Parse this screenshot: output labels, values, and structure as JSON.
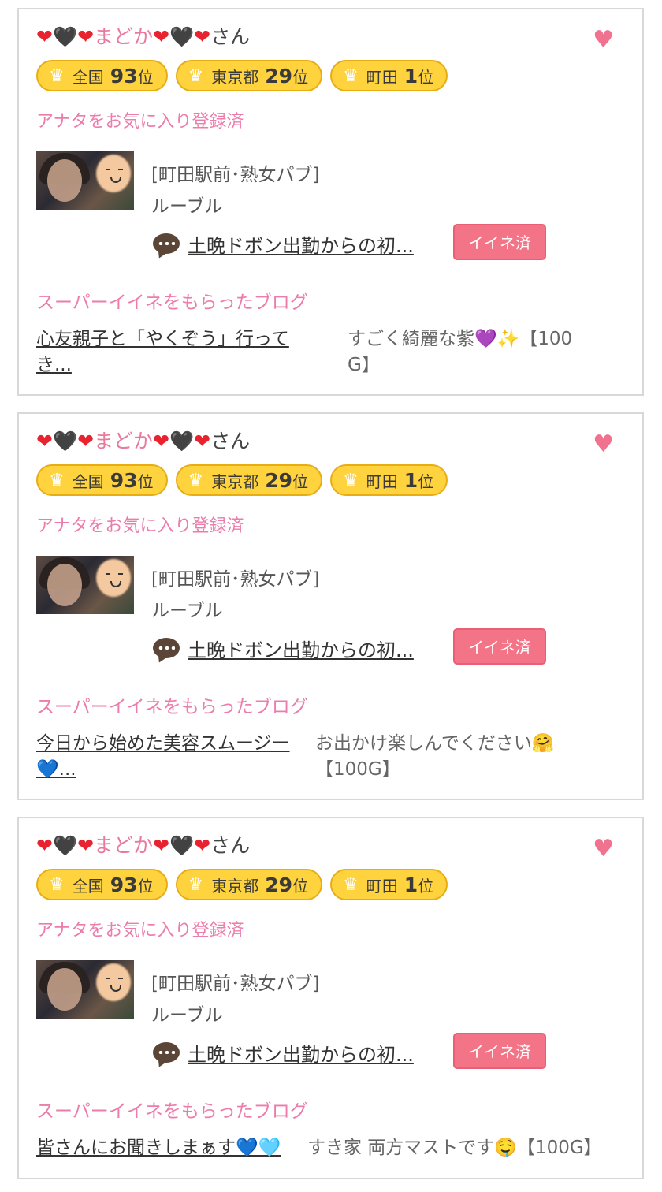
{
  "cards": [
    {
      "name_prefix": "❤🖤❤",
      "name_main": "まどか",
      "name_suffix_hearts": "❤🖤❤",
      "name_suffix": "さん",
      "badges": [
        {
          "area": "全国",
          "rank": "93",
          "unit": "位"
        },
        {
          "area": "東京都",
          "rank": "29",
          "unit": "位"
        },
        {
          "area": "町田",
          "rank": "1",
          "unit": "位"
        }
      ],
      "fav_status": "アナタをお気に入り登録済",
      "shop_line1": "[町田駅前･熟女パブ]",
      "shop_line2": "ルーブル",
      "comment_link": "土晩ドボン出勤からの初...",
      "iine_label": "イイネ済",
      "super_title": "スーパーイイネをもらったブログ",
      "blog_link_line1": "心友親子と「やくぞう」行って",
      "blog_link_line2": "き...",
      "blog_comment_line1": "すごく綺麗な紫💜✨【100",
      "blog_comment_line2": "G】"
    },
    {
      "name_prefix": "❤🖤❤",
      "name_main": "まどか",
      "name_suffix_hearts": "❤🖤❤",
      "name_suffix": "さん",
      "badges": [
        {
          "area": "全国",
          "rank": "93",
          "unit": "位"
        },
        {
          "area": "東京都",
          "rank": "29",
          "unit": "位"
        },
        {
          "area": "町田",
          "rank": "1",
          "unit": "位"
        }
      ],
      "fav_status": "アナタをお気に入り登録済",
      "shop_line1": "[町田駅前･熟女パブ]",
      "shop_line2": "ルーブル",
      "comment_link": "土晩ドボン出勤からの初...",
      "iine_label": "イイネ済",
      "super_title": "スーパーイイネをもらったブログ",
      "blog_link_line1": "今日から始めた美容スムージー",
      "blog_link_line2": "💙...",
      "blog_comment_line1": "お出かけ楽しんでください🤗",
      "blog_comment_line2": "【100G】"
    },
    {
      "name_prefix": "❤🖤❤",
      "name_main": "まどか",
      "name_suffix_hearts": "❤🖤❤",
      "name_suffix": "さん",
      "badges": [
        {
          "area": "全国",
          "rank": "93",
          "unit": "位"
        },
        {
          "area": "東京都",
          "rank": "29",
          "unit": "位"
        },
        {
          "area": "町田",
          "rank": "1",
          "unit": "位"
        }
      ],
      "fav_status": "アナタをお気に入り登録済",
      "shop_line1": "[町田駅前･熟女パブ]",
      "shop_line2": "ルーブル",
      "comment_link": "土晩ドボン出勤からの初...",
      "iine_label": "イイネ済",
      "super_title": "スーパーイイネをもらったブログ",
      "blog_link_line1": "皆さんにお聞きしまぁす💙🩵",
      "blog_comment_line1": "すき家 両方マストです🤤【100G】"
    }
  ],
  "colors": {
    "accent_pink": "#ec7cab",
    "badge_yellow": "#ffd33d",
    "iine_red": "#f37487",
    "heart_pink": "#f0728f"
  },
  "icons": {
    "favorite": "heart-icon",
    "badge": "crown-icon",
    "comment": "speech-bubble-icon"
  }
}
